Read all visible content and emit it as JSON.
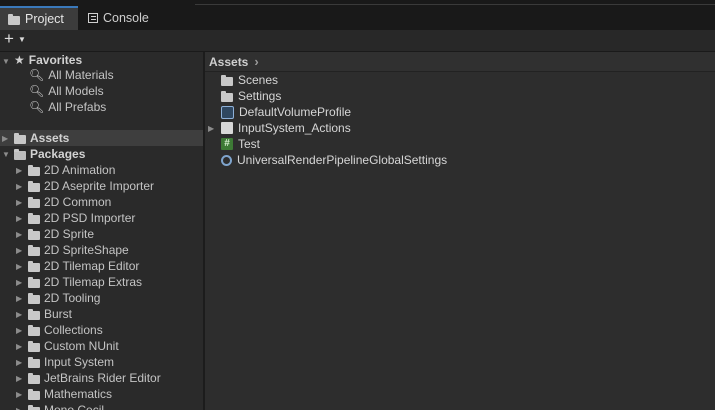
{
  "tabs": [
    {
      "label": "Project",
      "icon": "folder-icon"
    },
    {
      "label": "Console",
      "icon": "console-icon"
    }
  ],
  "toolbar": {
    "add_label": "+"
  },
  "sidebar": {
    "favorites": {
      "label": "Favorites",
      "items": [
        "All Materials",
        "All Models",
        "All Prefabs"
      ]
    },
    "assets_label": "Assets",
    "packages": {
      "label": "Packages",
      "items": [
        "2D Animation",
        "2D Aseprite Importer",
        "2D Common",
        "2D PSD Importer",
        "2D Sprite",
        "2D SpriteShape",
        "2D Tilemap Editor",
        "2D Tilemap Extras",
        "2D Tooling",
        "Burst",
        "Collections",
        "Custom NUnit",
        "Input System",
        "JetBrains Rider Editor",
        "Mathematics",
        "Mono Cecil"
      ]
    }
  },
  "main": {
    "breadcrumb": "Assets",
    "files": [
      {
        "name": "Scenes",
        "icon": "folder-icon"
      },
      {
        "name": "Settings",
        "icon": "folder-icon"
      },
      {
        "name": "DefaultVolumeProfile",
        "icon": "volume-profile-icon"
      },
      {
        "name": "InputSystem_Actions",
        "icon": "input-actions-icon"
      },
      {
        "name": "Test",
        "icon": "script-icon"
      },
      {
        "name": "UniversalRenderPipelineGlobalSettings",
        "icon": "render-settings-icon"
      }
    ]
  }
}
